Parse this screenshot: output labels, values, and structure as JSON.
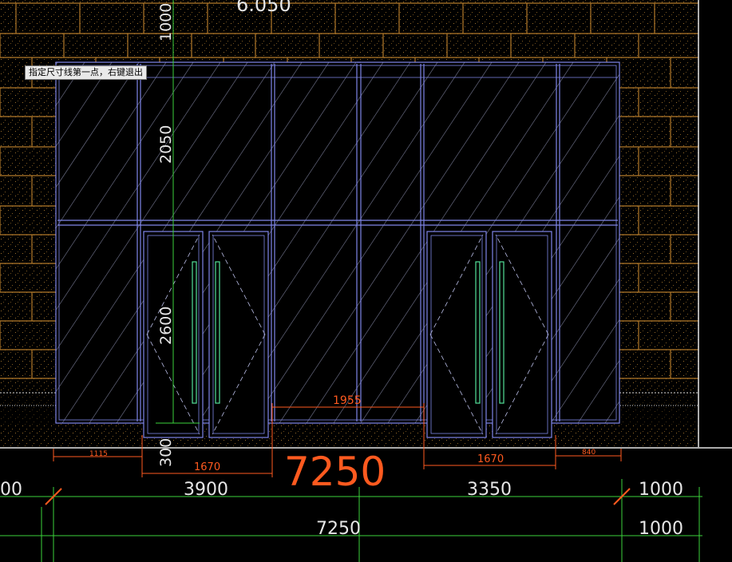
{
  "tooltip": "指定尺寸线第一点，右键退出",
  "elevation_label": "6.050",
  "vertical_dims": [
    "1000",
    "2050",
    "2600",
    "300"
  ],
  "orange_dims": {
    "d1115": "1115",
    "d1670_left": "1670",
    "d1955": "1955",
    "d1670_right": "1670",
    "d840": "840"
  },
  "total_large": "7250",
  "row1_dims": {
    "left_clip": "00",
    "d3900": "3900",
    "d3350": "3350",
    "d1000": "1000"
  },
  "row2_dims": {
    "d7250": "7250",
    "d1000": "1000"
  },
  "colors": {
    "background": "#000000",
    "frame_blue": "#7f86e8",
    "glass_hatch": "#b9bde6",
    "handle_green": "#54e39a",
    "guide_green": "#3bd23b",
    "dim_orange": "#ff5a1f",
    "dim_white": "#e6e6e6",
    "brick_line": "#b47a2a"
  }
}
